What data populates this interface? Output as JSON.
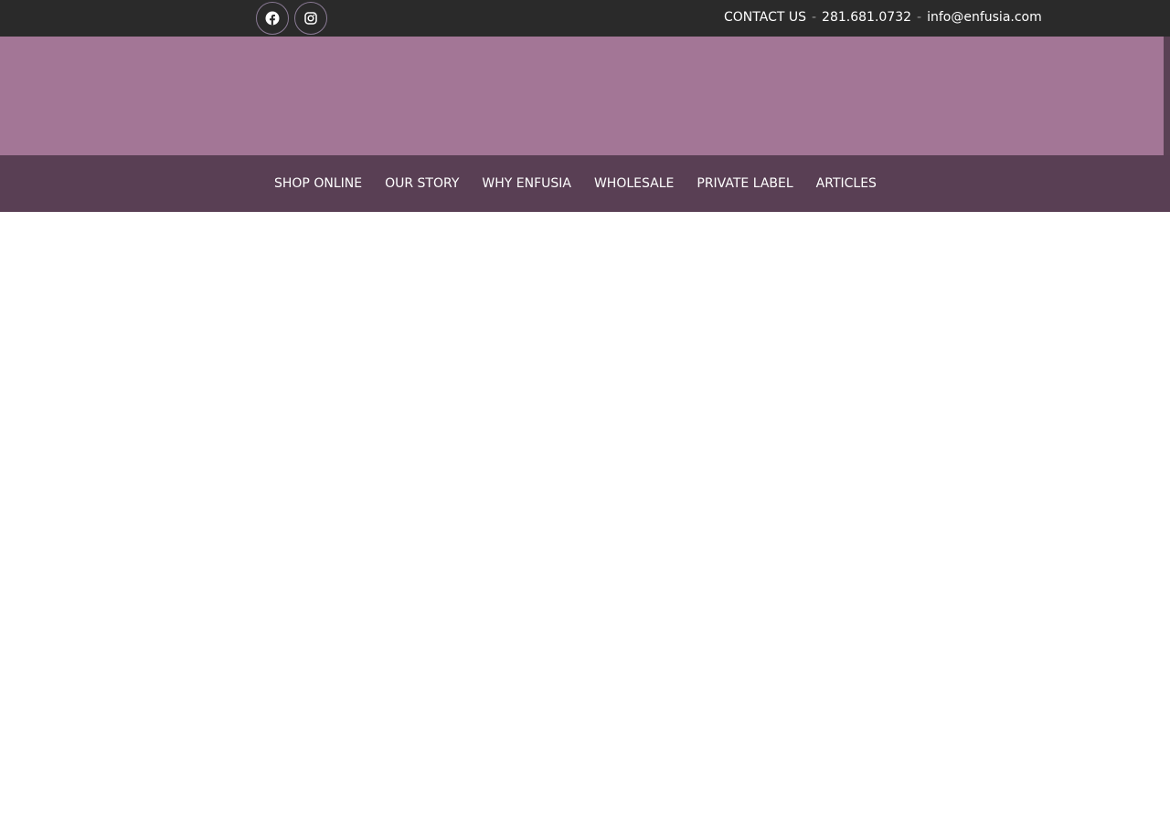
{
  "colors": {
    "topbar_bg": "#2a2a2a",
    "banner_bg": "#a37696",
    "nav_bg": "#593f54",
    "text_light": "#ffffff"
  },
  "social": [
    {
      "name": "facebook",
      "icon": "facebook-icon"
    },
    {
      "name": "instagram",
      "icon": "instagram-icon"
    }
  ],
  "contact": {
    "label": "CONTACT US",
    "separator": "-",
    "phone": "281.681.0732",
    "email": "info@enfusia.com"
  },
  "nav": {
    "items": [
      {
        "label": "SHOP ONLINE"
      },
      {
        "label": "OUR STORY"
      },
      {
        "label": "WHY ENFUSIA"
      },
      {
        "label": "WHOLESALE"
      },
      {
        "label": "PRIVATE LABEL"
      },
      {
        "label": "ARTICLES"
      }
    ]
  }
}
